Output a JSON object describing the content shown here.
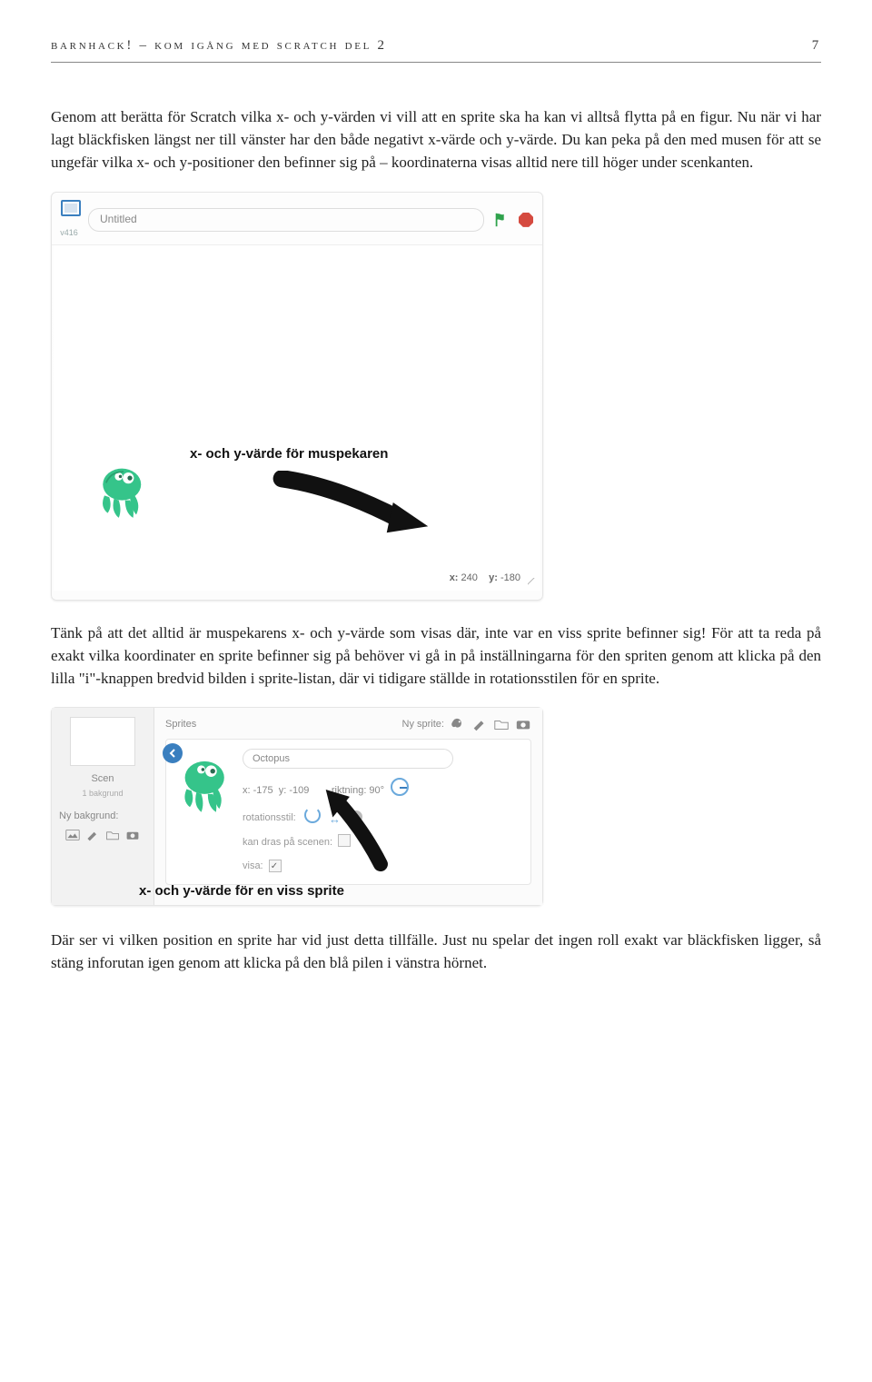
{
  "header": {
    "title": "barnhack! – kom igång med scratch del 2",
    "page": "7"
  },
  "para1": "Genom att berätta för Scratch vilka x- och y-värden vi vill att en sprite ska ha kan vi alltså flytta på en figur. Nu när vi har lagt bläckfisken längst ner till vänster har den både negativt x-värde och y-värde. Du kan peka på den med musen för att se ungefär vilka x- och y-positioner den befinner sig på – koordinaterna visas alltid nere till höger under scenkanten.",
  "shot1": {
    "version": "v416",
    "title": "Untitled",
    "annot": "x- och y-värde för muspekaren",
    "xlabel": "x:",
    "xval": "240",
    "ylabel": "y:",
    "yval": "-180"
  },
  "para2": "Tänk på att det alltid är muspekarens x- och y-värde som visas där, inte var en viss sprite befinner sig! För att ta reda på exakt vilka koordinater en sprite befinner sig på behöver vi gå in på inställningarna för den spriten genom att klicka på den lilla \"i\"-knappen bredvid bilden i sprite-listan, där vi tidigare ställde in rotationsstilen för en sprite.",
  "shot2": {
    "scen": "Scen",
    "bakgrund": "1 bakgrund",
    "nybg": "Ny bakgrund:",
    "sprites": "Sprites",
    "nysprite": "Ny sprite:",
    "name": "Octopus",
    "x": "x: -175",
    "y": "y: -109",
    "riktning": "riktning: 90°",
    "rotationsstil": "rotationsstil:",
    "drag": "kan dras på scenen:",
    "visa": "visa:",
    "annot": "x- och y-värde för en viss sprite"
  },
  "para3": "Där ser vi vilken position en sprite har vid just detta tillfälle. Just nu spelar det ingen roll exakt var bläckfisken ligger, så stäng inforutan igen genom att klicka på den blå pilen i vänstra hörnet."
}
